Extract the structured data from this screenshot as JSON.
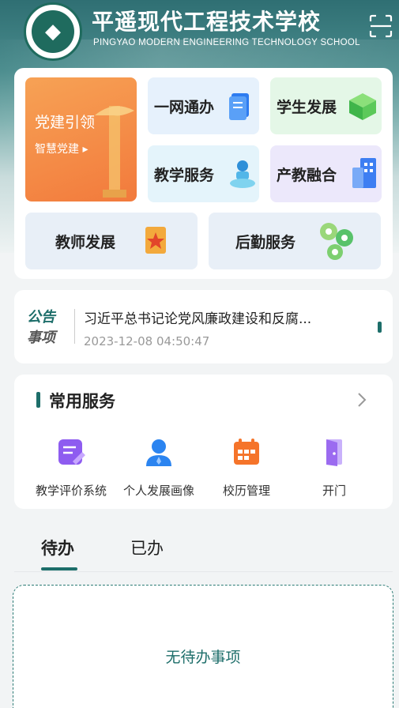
{
  "header": {
    "school_name_cn": "平遥现代工程技术学校",
    "school_name_en": "PINGYAO MODERN ENGINEERING TECHNOLOGY SCHOOL",
    "scan_icon": "scan-icon"
  },
  "menu": {
    "party": {
      "title": "党建引领",
      "subtitle": "智慧党建 ▸"
    },
    "items": [
      {
        "label": "一网通办",
        "icon": "document-icon"
      },
      {
        "label": "学生发展",
        "icon": "cube-icon"
      },
      {
        "label": "教学服务",
        "icon": "teacher-desk-icon"
      },
      {
        "label": "产教融合",
        "icon": "building-icon"
      },
      {
        "label": "教师发展",
        "icon": "flag-icon"
      },
      {
        "label": "后勤服务",
        "icon": "gears-icon"
      }
    ]
  },
  "notice": {
    "label_line1": "公告",
    "label_line2": "事项",
    "title": "习近平总书记论党风廉政建设和反腐...",
    "time": "2023-12-08 04:50:47"
  },
  "services": {
    "title": "常用服务",
    "items": [
      {
        "label": "教学评价系统",
        "icon": "edit-note-icon",
        "color": "#8e5cf0"
      },
      {
        "label": "个人发展画像",
        "icon": "person-icon",
        "color": "#2b84f0"
      },
      {
        "label": "校历管理",
        "icon": "calendar-icon",
        "color": "#f5742a"
      },
      {
        "label": "开门",
        "icon": "door-icon",
        "color": "#9b6bf0"
      }
    ]
  },
  "tabs": {
    "pending": "待办",
    "done": "已办"
  },
  "todo": {
    "empty_text": "无待办事项"
  },
  "colors": {
    "accent": "#1d6e6a",
    "party_orange": "#f27a3c"
  }
}
